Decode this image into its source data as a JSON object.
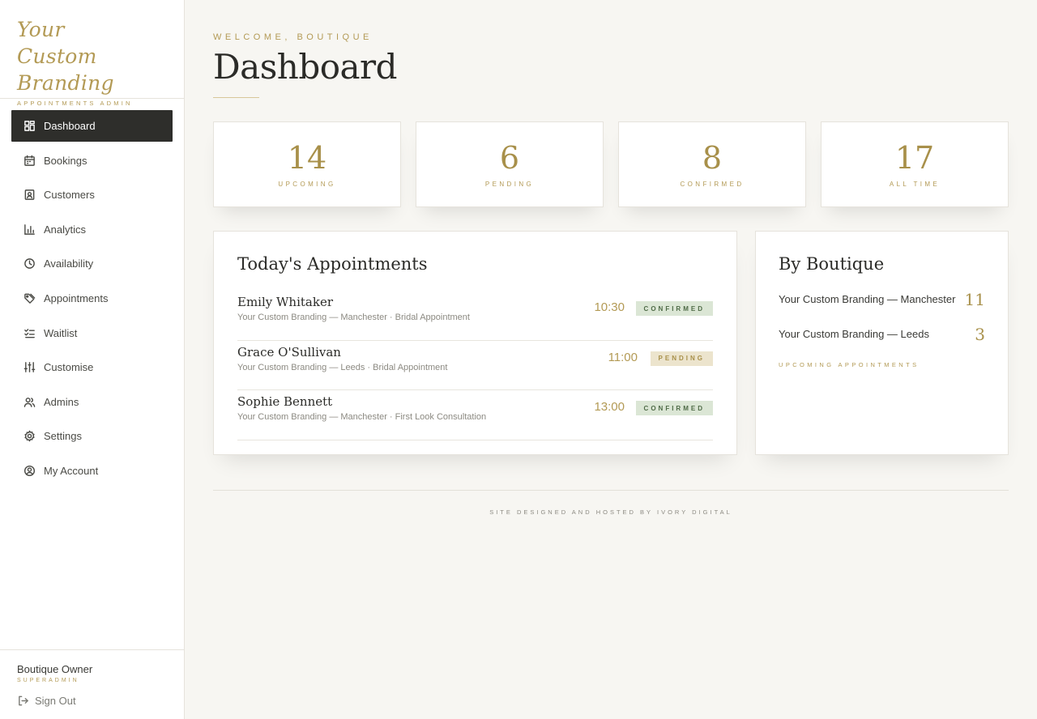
{
  "brand": {
    "script": "Your Custom Branding",
    "subtitle": "APPOINTMENTS ADMIN"
  },
  "nav": [
    {
      "label": "Dashboard",
      "icon": "dashboard-icon",
      "active": true
    },
    {
      "label": "Bookings",
      "icon": "calendar-icon"
    },
    {
      "label": "Customers",
      "icon": "contact-icon"
    },
    {
      "label": "Analytics",
      "icon": "bar-chart-icon"
    },
    {
      "label": "Availability",
      "icon": "clock-icon"
    },
    {
      "label": "Appointments",
      "icon": "tag-icon"
    },
    {
      "label": "Waitlist",
      "icon": "checklist-icon"
    },
    {
      "label": "Customise",
      "icon": "sliders-icon"
    },
    {
      "label": "Admins",
      "icon": "users-icon"
    },
    {
      "label": "Settings",
      "icon": "gear-icon"
    },
    {
      "label": "My Account",
      "icon": "user-circle-icon"
    }
  ],
  "user": {
    "name": "Boutique Owner",
    "role": "SUPERADMIN",
    "signout": "Sign Out"
  },
  "header": {
    "welcome": "WELCOME, BOUTIQUE",
    "title": "Dashboard"
  },
  "stats": [
    {
      "value": "14",
      "label": "UPCOMING"
    },
    {
      "value": "6",
      "label": "PENDING"
    },
    {
      "value": "8",
      "label": "CONFIRMED"
    },
    {
      "value": "17",
      "label": "ALL TIME"
    }
  ],
  "today": {
    "title": "Today's Appointments",
    "items": [
      {
        "name": "Emily Whitaker",
        "meta": "Your Custom Branding — Manchester · Bridal Appointment",
        "time": "10:30",
        "status": "CONFIRMED"
      },
      {
        "name": "Grace O'Sullivan",
        "meta": "Your Custom Branding — Leeds · Bridal Appointment",
        "time": "11:00",
        "status": "PENDING"
      },
      {
        "name": "Sophie Bennett",
        "meta": "Your Custom Branding — Manchester · First Look Consultation",
        "time": "13:00",
        "status": "CONFIRMED"
      }
    ]
  },
  "by_boutique": {
    "title": "By Boutique",
    "items": [
      {
        "name": "Your Custom Branding — Manchester",
        "count": "11"
      },
      {
        "name": "Your Custom Branding — Leeds",
        "count": "3"
      }
    ],
    "caption": "UPCOMING APPOINTMENTS"
  },
  "footer": "SITE DESIGNED AND HOSTED BY IVORY DIGITAL",
  "colors": {
    "accent": "#b39a55",
    "dark": "#2e2e2b",
    "confirmed_bg": "#dbe6d5",
    "pending_bg": "#ece4cd"
  }
}
